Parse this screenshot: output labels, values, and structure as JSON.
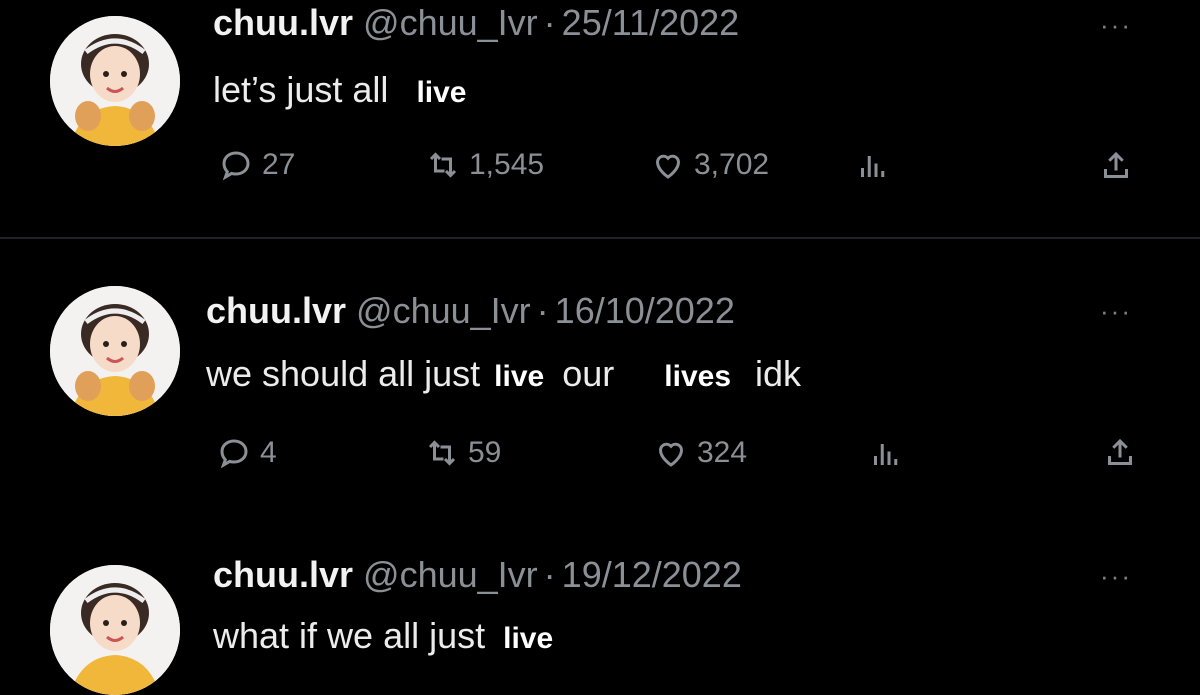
{
  "tweets": [
    {
      "name": "chuu.lvr",
      "handle": "@chuu_Ivr",
      "date": "25/11/2022",
      "text": "let’s just all",
      "overlay_1": "live",
      "overlay_2": "",
      "text_2": "",
      "text_3": "",
      "replies": "27",
      "retweets": "1,545",
      "likes": "3,702",
      "more": "···"
    },
    {
      "name": "chuu.lvr",
      "handle": "@chuu_Ivr",
      "date": "16/10/2022",
      "text": "we should all just",
      "overlay_1": "live",
      "text_2": "our",
      "overlay_2": "lives",
      "text_3": "idk",
      "replies": "4",
      "retweets": "59",
      "likes": "324",
      "more": "···"
    },
    {
      "name": "chuu.lvr",
      "handle": "@chuu_Ivr",
      "date": "19/12/2022",
      "text": "what if we all just",
      "overlay_1": "live",
      "more": "···"
    }
  ],
  "separator": "·",
  "icons": {
    "reply": "reply-icon",
    "retweet": "retweet-icon",
    "like": "heart-icon",
    "views": "analytics-icon",
    "share": "share-icon",
    "more": "more-icon"
  }
}
